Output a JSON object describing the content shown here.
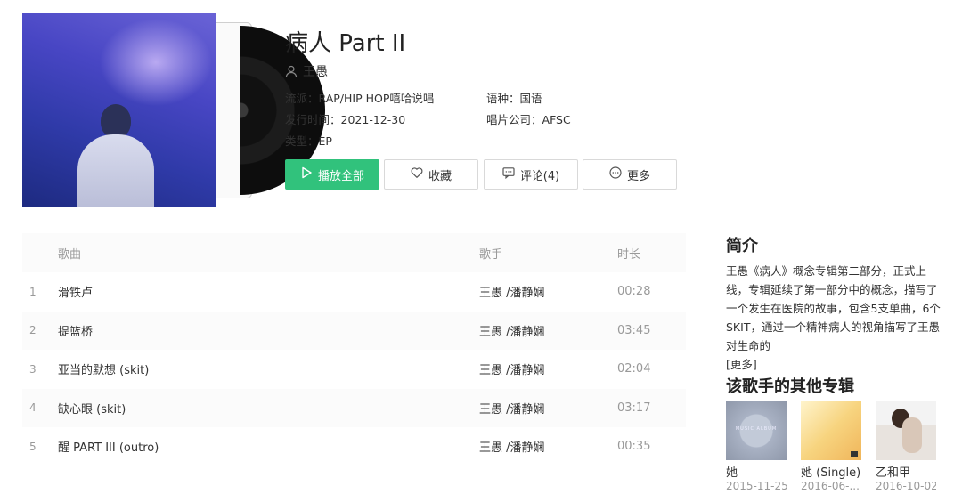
{
  "album": {
    "title": "病人 Part II",
    "artist": "王愚",
    "genre_label": "流派：",
    "genre_value": "RAP/HIP HOP嘻哈说唱",
    "language_label": "语种：",
    "language_value": "国语",
    "release_label": "发行时间：",
    "release_value": "2021-12-30",
    "company_label": "唱片公司：",
    "company_value": "AFSC",
    "type_label": "类型：",
    "type_value": "EP"
  },
  "actions": {
    "play_all": "播放全部",
    "favorite": "收藏",
    "comments": "评论(4)",
    "more": "更多"
  },
  "tracklist": {
    "headers": {
      "song": "歌曲",
      "singer": "歌手",
      "duration": "时长"
    },
    "tracks": [
      {
        "num": "1",
        "title": "滑铁卢",
        "singer": "王愚 /潘静娴",
        "duration": "00:28"
      },
      {
        "num": "2",
        "title": "提篮桥",
        "singer": "王愚 /潘静娴",
        "duration": "03:45"
      },
      {
        "num": "3",
        "title": "亚当的默想 (skit)",
        "singer": "王愚 /潘静娴",
        "duration": "02:04"
      },
      {
        "num": "4",
        "title": "缺心眼 (skit)",
        "singer": "王愚 /潘静娴",
        "duration": "03:17"
      },
      {
        "num": "5",
        "title": "醒 PART III (outro)",
        "singer": "王愚 /潘静娴",
        "duration": "00:35"
      }
    ]
  },
  "intro": {
    "title": "简介",
    "text": "王愚《病人》概念专辑第二部分，正式上线，专辑延续了第一部分中的概念，描写了一个发生在医院的故事，包含5支单曲，6个 SKIT，通过一个精神病人的视角描写了王愚对生命的",
    "more": "[更多]"
  },
  "other_albums": {
    "title": "该歌手的其他专辑",
    "items": [
      {
        "name": "她",
        "date": "2015-11-25",
        "cover_text": "MUSIC ALBUM"
      },
      {
        "name": "她 (Single)",
        "date": "2016-06-..."
      },
      {
        "name": "乙和甲",
        "date": "2016-10-02"
      }
    ]
  },
  "colors": {
    "accent": "#31c27c",
    "muted": "#999999",
    "text": "#333333"
  },
  "icons": {
    "play": "play-icon",
    "favorite": "heart-icon",
    "comment": "comment-icon",
    "more": "more-icon",
    "artist": "user-icon"
  }
}
